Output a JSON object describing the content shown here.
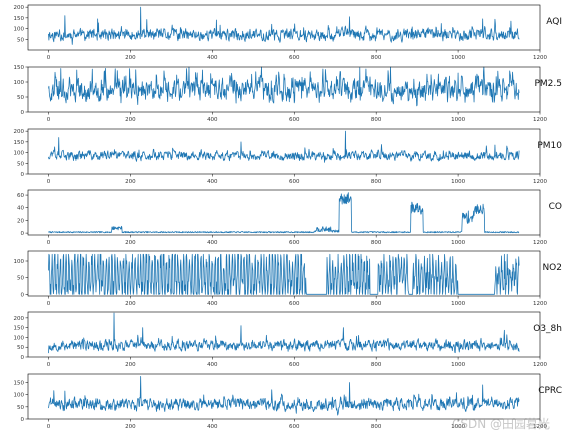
{
  "style": {
    "line_color": "#1f77b4",
    "axes_color": "#000000",
    "background": "#ffffff"
  },
  "watermark": "CSDN @田园暮光",
  "chart_data": [
    {
      "type": "line",
      "series_label": "AQI",
      "xlim": [
        -50,
        1200
      ],
      "ylim": [
        0,
        210
      ],
      "xticks": [
        0,
        200,
        400,
        600,
        800,
        1000,
        1200
      ],
      "yticks": [
        50,
        100,
        150,
        200
      ],
      "ytick_labels": [
        "50",
        "100",
        "150",
        "200"
      ],
      "kind": "aqi",
      "base": 70,
      "amp": 45,
      "min": 20,
      "max": 200,
      "seed": 11,
      "anchors": [
        [
          0,
          75
        ],
        [
          40,
          160
        ],
        [
          120,
          145
        ],
        [
          225,
          200
        ],
        [
          300,
          80
        ],
        [
          410,
          140
        ],
        [
          545,
          120
        ],
        [
          735,
          155
        ],
        [
          1060,
          145
        ],
        [
          1150,
          45
        ]
      ]
    },
    {
      "type": "line",
      "series_label": "PM2.5",
      "xlim": [
        -50,
        1200
      ],
      "ylim": [
        0,
        150
      ],
      "xticks": [
        0,
        200,
        400,
        600,
        800,
        1000,
        1200
      ],
      "yticks": [
        0,
        50,
        100,
        150
      ],
      "ytick_labels": [
        "0",
        "50",
        "100",
        "150"
      ],
      "kind": "dense",
      "base": 70,
      "amp": 55,
      "min": 5,
      "max": 150,
      "seed": 23,
      "anchors": [
        [
          30,
          145
        ],
        [
          760,
          148
        ],
        [
          1000,
          130
        ]
      ]
    },
    {
      "type": "line",
      "series_label": "PM10",
      "xlim": [
        -50,
        1200
      ],
      "ylim": [
        0,
        210
      ],
      "xticks": [
        0,
        200,
        400,
        600,
        800,
        1000,
        1200
      ],
      "yticks": [
        0,
        50,
        100,
        150,
        200
      ],
      "ytick_labels": [
        "0",
        "50",
        "100",
        "150",
        "200"
      ],
      "kind": "noisy",
      "base": 85,
      "amp": 35,
      "min": 30,
      "max": 200,
      "seed": 37,
      "anchors": [
        [
          0,
          80
        ],
        [
          25,
          170
        ],
        [
          470,
          150
        ],
        [
          725,
          200
        ],
        [
          1090,
          135
        ],
        [
          1150,
          95
        ]
      ]
    },
    {
      "type": "line",
      "series_label": "CO",
      "xlim": [
        -50,
        1200
      ],
      "ylim": [
        -3,
        68
      ],
      "xticks": [
        0,
        200,
        400,
        600,
        800,
        1000,
        1200
      ],
      "yticks": [
        0,
        20,
        40,
        60
      ],
      "ytick_labels": [
        "0",
        "20",
        "40",
        "60"
      ],
      "kind": "co",
      "segments": [
        [
          0,
          155,
          1.5,
          1
        ],
        [
          155,
          180,
          8,
          3
        ],
        [
          180,
          650,
          1.5,
          1
        ],
        [
          650,
          690,
          6,
          4
        ],
        [
          690,
          710,
          3,
          2
        ],
        [
          710,
          740,
          55,
          10
        ],
        [
          740,
          885,
          1.5,
          1
        ],
        [
          885,
          915,
          40,
          10
        ],
        [
          915,
          1000,
          1.5,
          1
        ],
        [
          1000,
          1010,
          2,
          1
        ],
        [
          1010,
          1040,
          25,
          10
        ],
        [
          1040,
          1065,
          38,
          8
        ],
        [
          1065,
          1150,
          1.5,
          1
        ]
      ]
    },
    {
      "type": "line",
      "series_label": "NO2",
      "xlim": [
        -50,
        1200
      ],
      "ylim": [
        -5,
        130
      ],
      "xticks": [
        0,
        200,
        400,
        600,
        800,
        1000,
        1200
      ],
      "yticks": [
        0,
        50,
        100
      ],
      "ytick_labels": [
        "0",
        "50",
        "100"
      ],
      "kind": "no2",
      "flat": [
        [
          630,
          680
        ],
        [
          785,
          805
        ],
        [
          880,
          890
        ],
        [
          1000,
          1090
        ]
      ]
    },
    {
      "type": "line",
      "series_label": "O3_8h",
      "xlim": [
        -50,
        1200
      ],
      "ylim": [
        0,
        230
      ],
      "xticks": [
        0,
        200,
        400,
        600,
        800,
        1000,
        1200
      ],
      "yticks": [
        0,
        50,
        100,
        150,
        200
      ],
      "ytick_labels": [
        "0",
        "50",
        "100",
        "150",
        "200"
      ],
      "kind": "noisy",
      "base": 60,
      "amp": 45,
      "min": 10,
      "max": 225,
      "seed": 53,
      "anchors": [
        [
          0,
          20
        ],
        [
          160,
          225
        ],
        [
          230,
          150
        ],
        [
          470,
          160
        ],
        [
          720,
          150
        ],
        [
          800,
          30
        ],
        [
          1100,
          40
        ],
        [
          1150,
          20
        ]
      ]
    },
    {
      "type": "line",
      "series_label": "CPRC",
      "xlim": [
        -50,
        1200
      ],
      "ylim": [
        0,
        185
      ],
      "xticks": [
        0,
        200,
        400,
        600,
        800,
        1000,
        1200
      ],
      "yticks": [
        0,
        50,
        100,
        150
      ],
      "ytick_labels": [
        "0",
        "50",
        "100",
        "150"
      ],
      "xtick_labels": [
        "0",
        "200",
        "400",
        "600",
        "800",
        "1000",
        "1200"
      ],
      "kind": "aqi",
      "base": 60,
      "amp": 40,
      "min": 10,
      "max": 175,
      "seed": 71,
      "anchors": [
        [
          0,
          45
        ],
        [
          40,
          115
        ],
        [
          225,
          175
        ],
        [
          300,
          80
        ],
        [
          545,
          120
        ],
        [
          735,
          150
        ],
        [
          1060,
          140
        ],
        [
          1150,
          60
        ]
      ]
    }
  ]
}
